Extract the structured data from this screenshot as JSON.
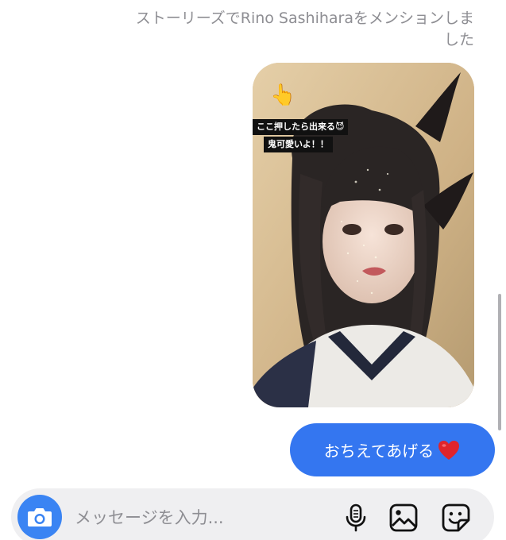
{
  "thread": {
    "mention_notice": "ストーリーズでRino Sashiharaをメンションしました",
    "story": {
      "pointer_emoji": "👆",
      "sticker_line1": "ここ押したら出来る😈",
      "sticker_line2": "鬼可愛いよ！！"
    },
    "outgoing_message": "おちえてあげる"
  },
  "composer": {
    "placeholder": "メッセージを入力..."
  },
  "colors": {
    "bubble": "#3476f0",
    "camera": "#3a84f3",
    "heart": "#e0242b"
  },
  "icons": [
    "camera-icon",
    "microphone-icon",
    "gallery-icon",
    "sticker-icon",
    "heart-icon"
  ]
}
